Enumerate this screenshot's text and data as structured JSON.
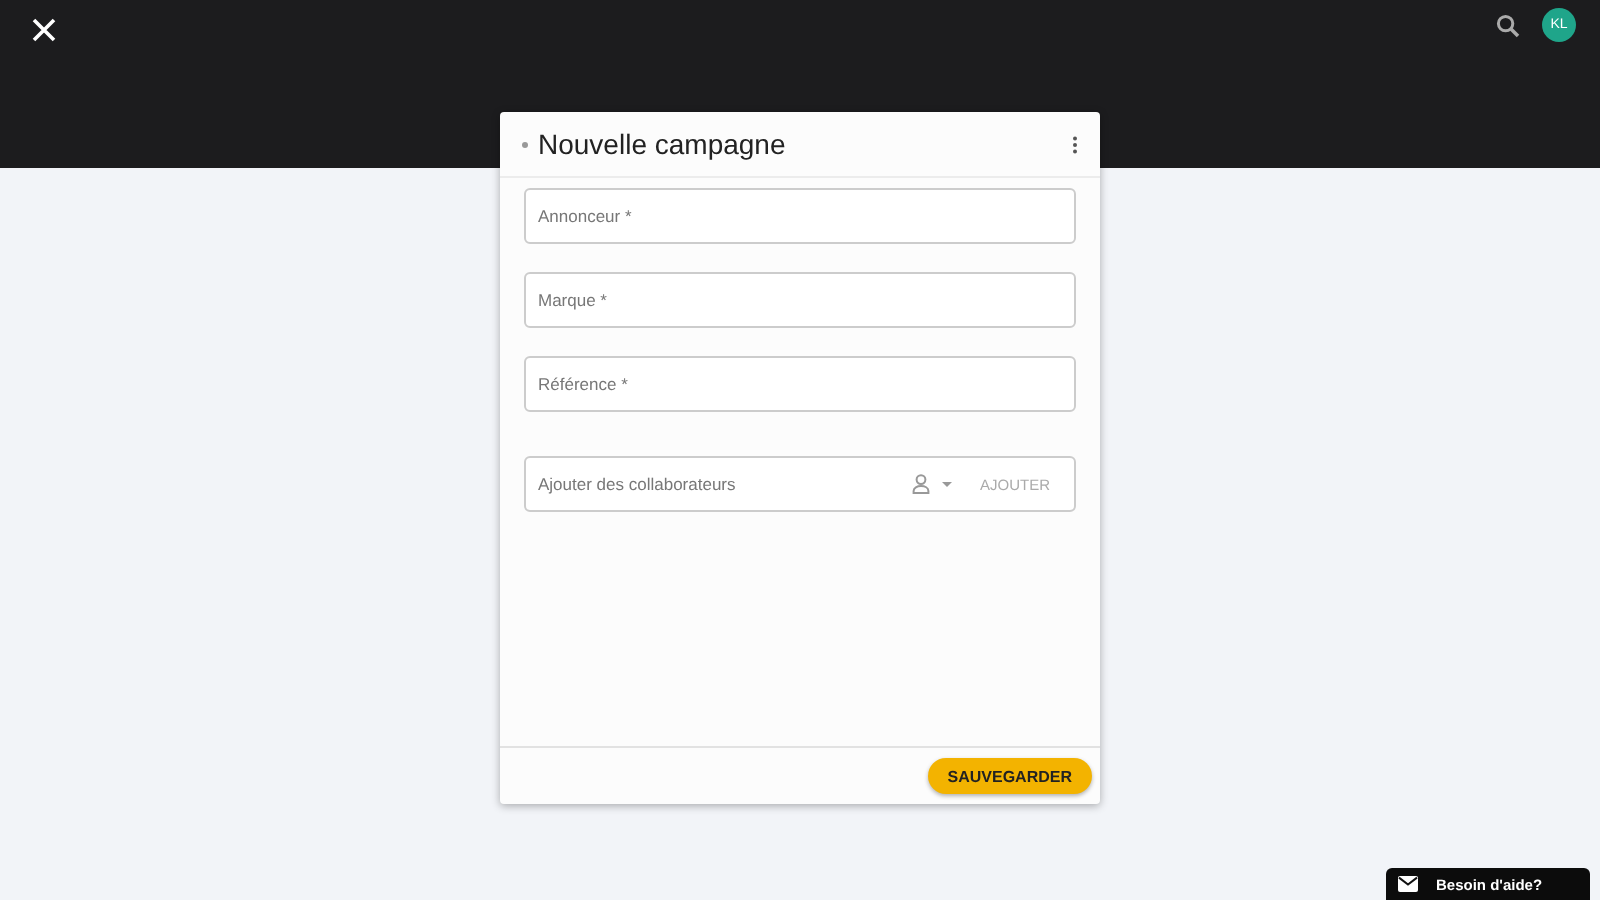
{
  "header": {
    "avatar": "KL"
  },
  "dialog": {
    "title": "Nouvelle campagne",
    "fields": [
      {
        "placeholder": "Annonceur *"
      },
      {
        "placeholder": "Marque *"
      },
      {
        "placeholder": "Référence *"
      }
    ],
    "collaborators": {
      "placeholder": "Ajouter des collaborateurs",
      "button": "AJOUTER"
    },
    "save_button": "SAUVEGARDER"
  },
  "help": {
    "label": "Besoin d'aide?"
  }
}
